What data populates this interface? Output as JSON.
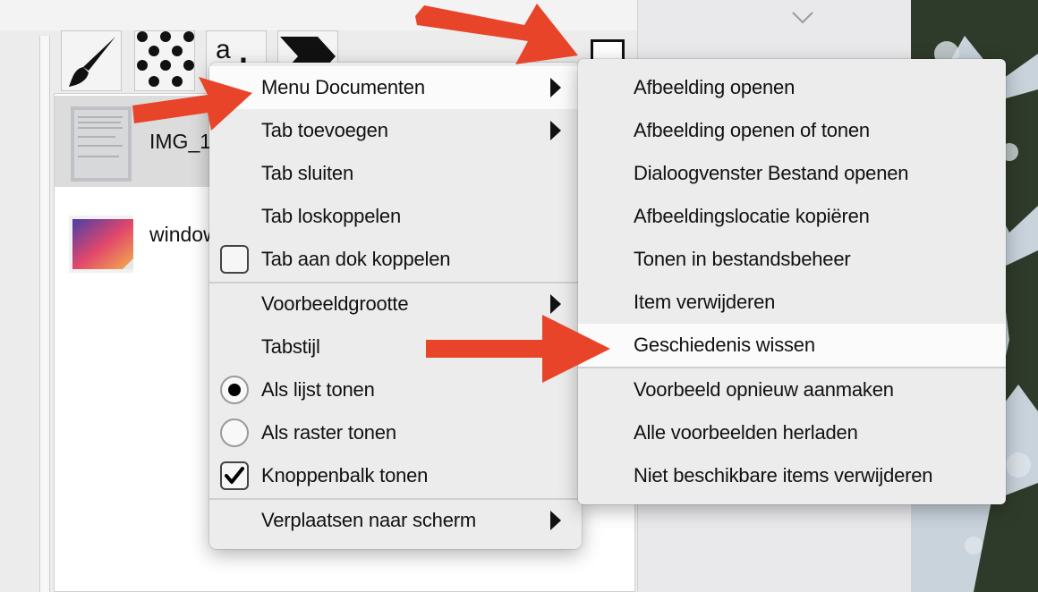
{
  "tab_strip": {
    "tabs": [
      {
        "icon": "brush-icon"
      },
      {
        "icon": "pattern-icon"
      },
      {
        "icon": "text-icon",
        "glyph": "a b"
      },
      {
        "icon": "chevron-brush-icon"
      }
    ]
  },
  "document_list": {
    "items": [
      {
        "name": "IMG_1",
        "icon": "scanned-document-icon",
        "selected": true
      },
      {
        "name": "window",
        "icon": "gradient-image-icon",
        "selected": false
      }
    ]
  },
  "context_menu": {
    "items": [
      {
        "label": "Menu Documenten",
        "submenu": true
      },
      {
        "label": "Tab toevoegen",
        "submenu": true
      },
      {
        "label": "Tab sluiten"
      },
      {
        "label": "Tab loskoppelen"
      },
      {
        "label": "Tab aan dok koppelen",
        "control": "checkbox",
        "checked": false
      },
      {
        "label": "Voorbeeldgrootte",
        "submenu": true
      },
      {
        "label": "Tabstijl"
      },
      {
        "label": "Als lijst tonen",
        "control": "radio",
        "checked": true
      },
      {
        "label": "Als raster tonen",
        "control": "radio",
        "checked": false
      },
      {
        "label": "Knoppenbalk tonen",
        "control": "checkbox",
        "checked": true
      },
      {
        "label": "Verplaatsen naar scherm",
        "submenu": true
      }
    ]
  },
  "submenu": {
    "items": [
      {
        "label": "Afbeelding openen"
      },
      {
        "label": "Afbeelding openen of tonen"
      },
      {
        "label": "Dialoogvenster Bestand openen"
      },
      {
        "label": "Afbeeldingslocatie kopiëren"
      },
      {
        "label": "Tonen in bestandsbeheer"
      },
      {
        "label": "Item verwijderen"
      },
      {
        "label": "Geschiedenis wissen"
      },
      {
        "label": "Voorbeeld opnieuw aanmaken"
      },
      {
        "label": "Alle voorbeelden herladen"
      },
      {
        "label": "Niet beschikbare items verwijderen"
      }
    ]
  },
  "colors": {
    "annotation_arrow": "#e8442a",
    "menu_background": "#ececec",
    "menu_highlight": "#fbfbfb"
  }
}
